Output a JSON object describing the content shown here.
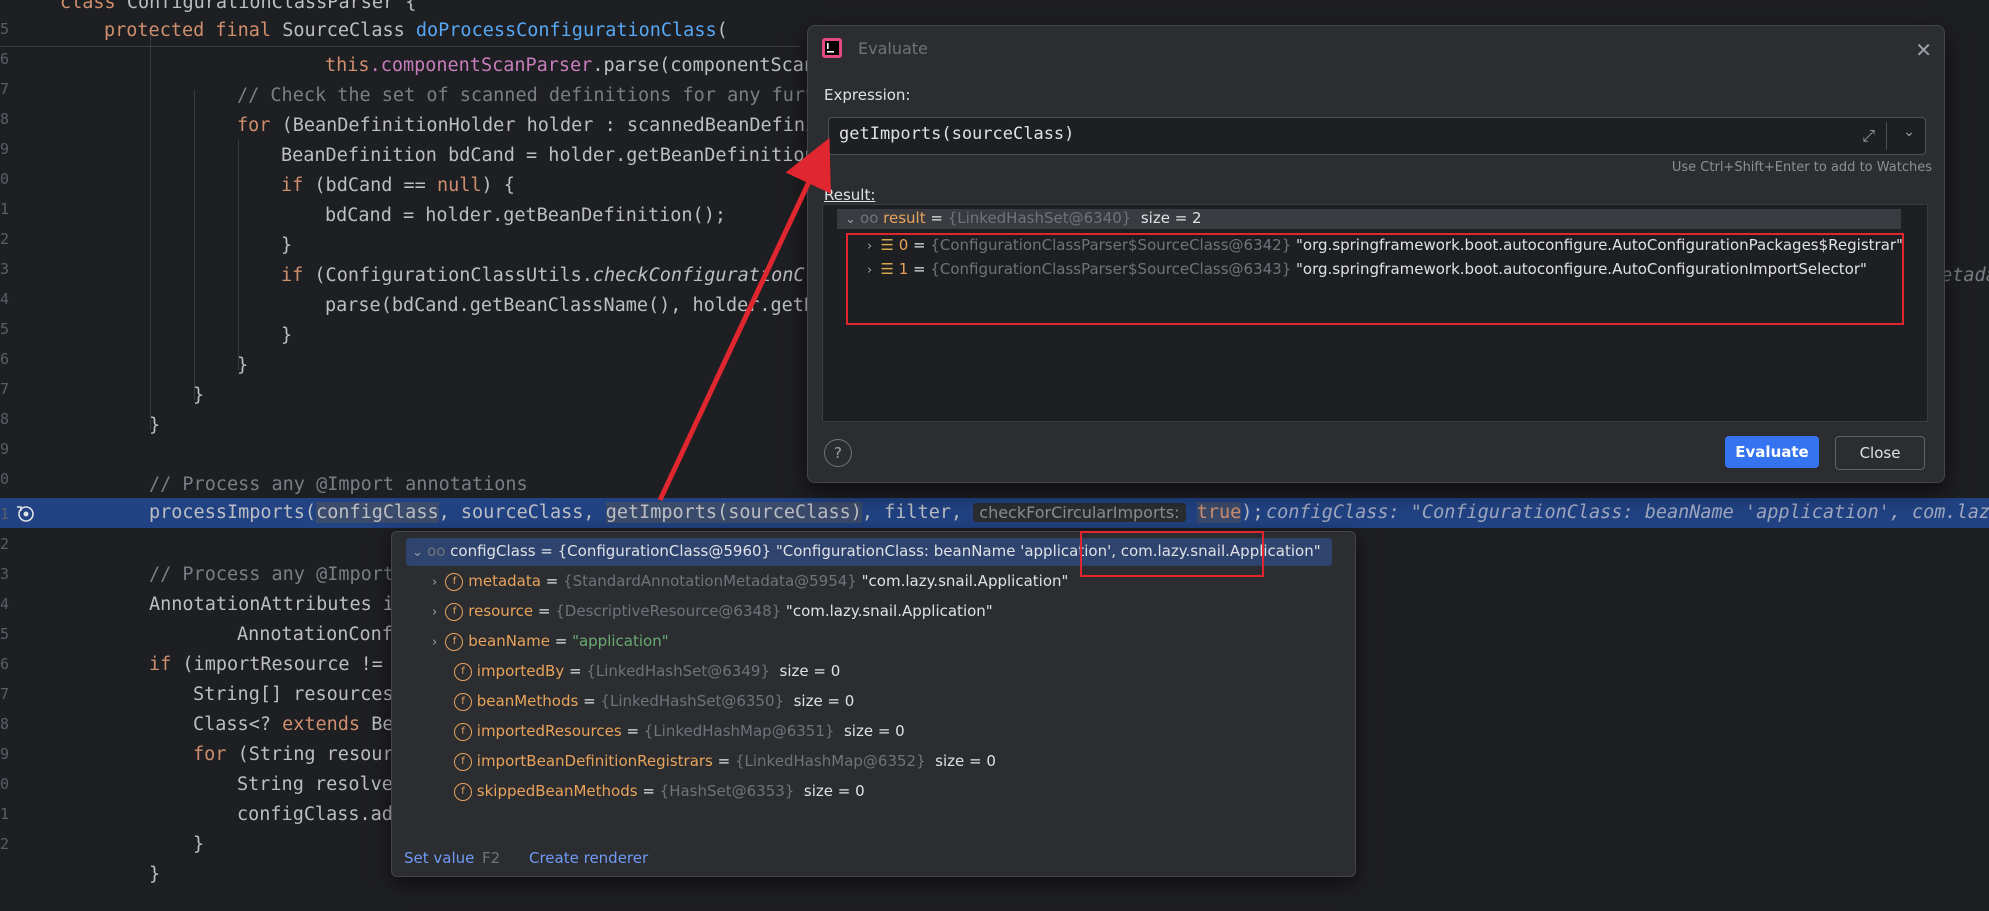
{
  "editor": {
    "lines": [
      {
        "n": "",
        "html_id": "l0"
      },
      {
        "n": "5"
      },
      {
        "n": "6"
      },
      {
        "n": "7"
      },
      {
        "n": "8"
      },
      {
        "n": "9"
      },
      {
        "n": "0"
      },
      {
        "n": "1"
      },
      {
        "n": "2"
      },
      {
        "n": "3"
      },
      {
        "n": "4"
      },
      {
        "n": "5"
      },
      {
        "n": "6"
      },
      {
        "n": "7"
      },
      {
        "n": "8"
      },
      {
        "n": "9"
      },
      {
        "n": "0"
      },
      {
        "n": "1"
      },
      {
        "n": "2"
      },
      {
        "n": "3"
      },
      {
        "n": "4"
      },
      {
        "n": "5"
      },
      {
        "n": "6"
      },
      {
        "n": "7"
      },
      {
        "n": "8"
      },
      {
        "n": "9"
      },
      {
        "n": "0"
      },
      {
        "n": "1"
      },
      {
        "n": "2"
      }
    ],
    "code": {
      "c0a": "class ",
      "c0b": "ConfigurationClassParser {",
      "c1a": "protected final ",
      "c1b": "SourceClass ",
      "c1c": "doProcessConfigurationClass",
      "c2a": "this",
      "c2b": ".componentScanParser",
      "c2c": ".parse(componentScan",
      "c3": "// Check the set of scanned definitions for any furt",
      "c4a": "for ",
      "c4b": "(BeanDefinitionHolder holder : scannedBeanDefini",
      "c5": "BeanDefinition bdCand = holder.getBeanDefinition",
      "c6a": "if ",
      "c6b": "(bdCand == ",
      "c6c": "null",
      "c6d": ") {",
      "c7": "bdCand = holder.getBeanDefinition();",
      "c8": "}",
      "c9a": "if ",
      "c9b": "(ConfigurationClassUtils.",
      "c9c": "checkConfigurationCl",
      "c10": "parse(bdCand.getBeanClassName(), holder.getB",
      "c11": "}",
      "c12": "}",
      "c13": "}",
      "c14": "}",
      "c15": "// Process any @Import annotations",
      "c16a": "processImports(",
      "c16b": "configClass",
      "c16c": ", sourceClass, ",
      "c16d": "getImports(sourceClass)",
      "c16e": ", filter, ",
      "c16hint": "checkForCircularImports:",
      "c16f": "true",
      "c16g": ");",
      "c16inline": "configClass: \"ConfigurationClass: beanName 'application', com.lazy",
      "c17": "// Process any @Import",
      "c18": "AnnotationAttributes i",
      "c19": "AnnotationConf",
      "c20a": "if ",
      "c20b": "(importResource != ",
      "c21": "String[] resources",
      "c22a": "Class<? ",
      "c22b": "extends ",
      "c22c": "Be",
      "c23a": "for ",
      "c23b": "(String resour",
      "c24": "String resolve",
      "c25": "configClass.ad",
      "c26": "}",
      "c27": "}",
      "c28": "Metada"
    }
  },
  "evaluate": {
    "title": "Evaluate",
    "expression_label": "Expression:",
    "expression": "getImports(sourceClass)",
    "watch_hint": "Use Ctrl+Shift+Enter to add to Watches",
    "result_label": "Result:",
    "result_root": {
      "name": "result",
      "eq": " = ",
      "type": "{LinkedHashSet@6340}",
      "size": "  size = 2"
    },
    "items": [
      {
        "idx": "0",
        "eq": " = ",
        "type": "{ConfigurationClassParser$SourceClass@6342}",
        "value": " \"org.springframework.boot.autoconfigure.AutoConfigurationPackages$Registrar\""
      },
      {
        "idx": "1",
        "eq": " = ",
        "type": "{ConfigurationClassParser$SourceClass@6343}",
        "value": " \"org.springframework.boot.autoconfigure.AutoConfigurationImportSelector\""
      }
    ],
    "help": "?",
    "evaluate_btn": "Evaluate",
    "close_btn": "Close"
  },
  "popup": {
    "root_a": "configClass = {ConfigurationClass@5960} \"ConfigurationClass: beanName 'application',",
    "root_b": " com.lazy.snail.Application\"",
    "fields": [
      {
        "name": "metadata",
        "eq": " = ",
        "type": "{StandardAnnotationMetadata@5954}",
        "value": " \"com.lazy.snail.Application\"",
        "expandable": true
      },
      {
        "name": "resource",
        "eq": " = ",
        "type": "{DescriptiveResource@6348}",
        "value": " \"com.lazy.snail.Application\"",
        "expandable": true
      },
      {
        "name": "beanName",
        "eq": " = ",
        "type": "",
        "value": "\"application\"",
        "expandable": true,
        "string": true
      },
      {
        "name": "importedBy",
        "eq": " = ",
        "type": "{LinkedHashSet@6349}",
        "value": "  size = 0",
        "expandable": false
      },
      {
        "name": "beanMethods",
        "eq": " = ",
        "type": "{LinkedHashSet@6350}",
        "value": "  size = 0",
        "expandable": false
      },
      {
        "name": "importedResources",
        "eq": " = ",
        "type": "{LinkedHashMap@6351}",
        "value": "  size = 0",
        "expandable": false
      },
      {
        "name": "importBeanDefinitionRegistrars",
        "eq": " = ",
        "type": "{LinkedHashMap@6352}",
        "value": "  size = 0",
        "expandable": false
      },
      {
        "name": "skippedBeanMethods",
        "eq": " = ",
        "type": "{HashSet@6353}",
        "value": "  size = 0",
        "expandable": false
      }
    ],
    "set_value": "Set value",
    "set_value_key": "F2",
    "create_renderer": "Create renderer"
  },
  "colors": {
    "accent": "#3574f0",
    "highlight_line": "#214283",
    "annotation_red": "#e0262f"
  }
}
